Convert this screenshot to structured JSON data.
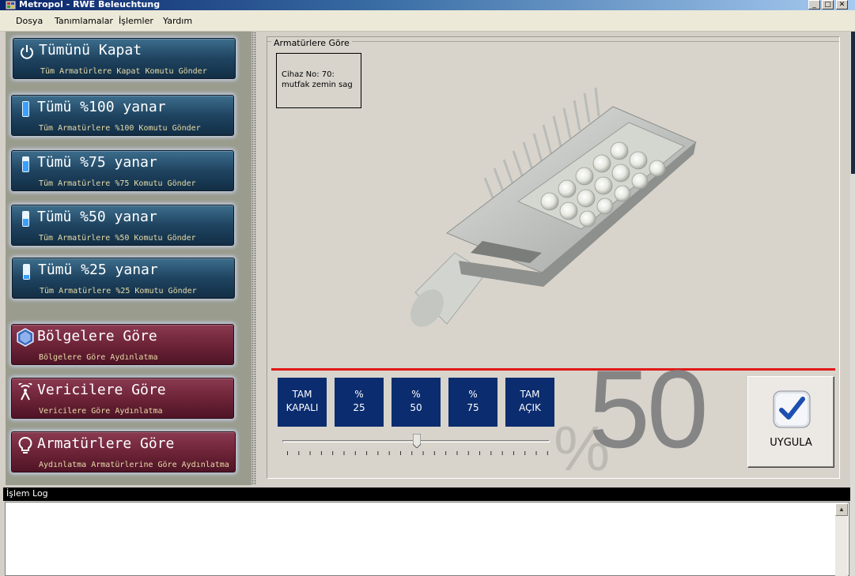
{
  "window": {
    "title": "Metropol - RWE Beleuchtung",
    "controls": [
      "_",
      "□",
      "✕"
    ]
  },
  "menu": {
    "items": [
      "Dosya",
      "Tanımlamalar",
      "İşlemler",
      "Yardım"
    ]
  },
  "sidebar": {
    "buttons": [
      {
        "label": "Tümünü Kapat",
        "sub": "Tüm Armatürlere Kapat Komutu Gönder",
        "icon": "power-icon"
      },
      {
        "label": "Tümü %100 yanar",
        "sub": "Tüm Armatürlere %100 Komutu Gönder",
        "icon": "level-100-icon"
      },
      {
        "label": "Tümü %75 yanar",
        "sub": "Tüm Armatürlere %75 Komutu Gönder",
        "icon": "level-75-icon"
      },
      {
        "label": "Tümü %50 yanar",
        "sub": "Tüm Armatürlere %50 Komutu Gönder",
        "icon": "level-50-icon"
      },
      {
        "label": "Tümü %25 yanar",
        "sub": "Tüm Armatürlere %25 Komutu Gönder",
        "icon": "level-25-icon"
      },
      {
        "label": "Bölgelere Göre",
        "sub": "Bölgelere Göre Aydınlatma",
        "icon": "hexagon-icon"
      },
      {
        "label": "Vericilere Göre",
        "sub": "Vericilere Göre Aydınlatma",
        "icon": "antenna-icon"
      },
      {
        "label": "Armatürlere Göre",
        "sub": "Aydınlatma Armatürlerine Göre Aydınlatma",
        "icon": "bulb-icon"
      }
    ]
  },
  "main": {
    "group_title": "Armatürlere Göre",
    "device": {
      "line1": "Cihaz No: 70:",
      "line2": "mutfak zemin sag"
    },
    "levels": [
      {
        "l1": "TAM",
        "l2": "KAPALI"
      },
      {
        "l1": "%",
        "l2": "25"
      },
      {
        "l1": "%",
        "l2": "50"
      },
      {
        "l1": "%",
        "l2": "75"
      },
      {
        "l1": "TAM",
        "l2": "AÇIK"
      }
    ],
    "slider_value_fraction": 0.5,
    "percent_symbol": "%",
    "percent_value": "50",
    "apply_label": "UYGULA"
  },
  "log": {
    "title": "İşlem Log"
  },
  "colors": {
    "accent_red": "#e01818",
    "level_button": "#0b2c6e",
    "blue_button": "#1f4461",
    "red_button": "#6e2438"
  }
}
